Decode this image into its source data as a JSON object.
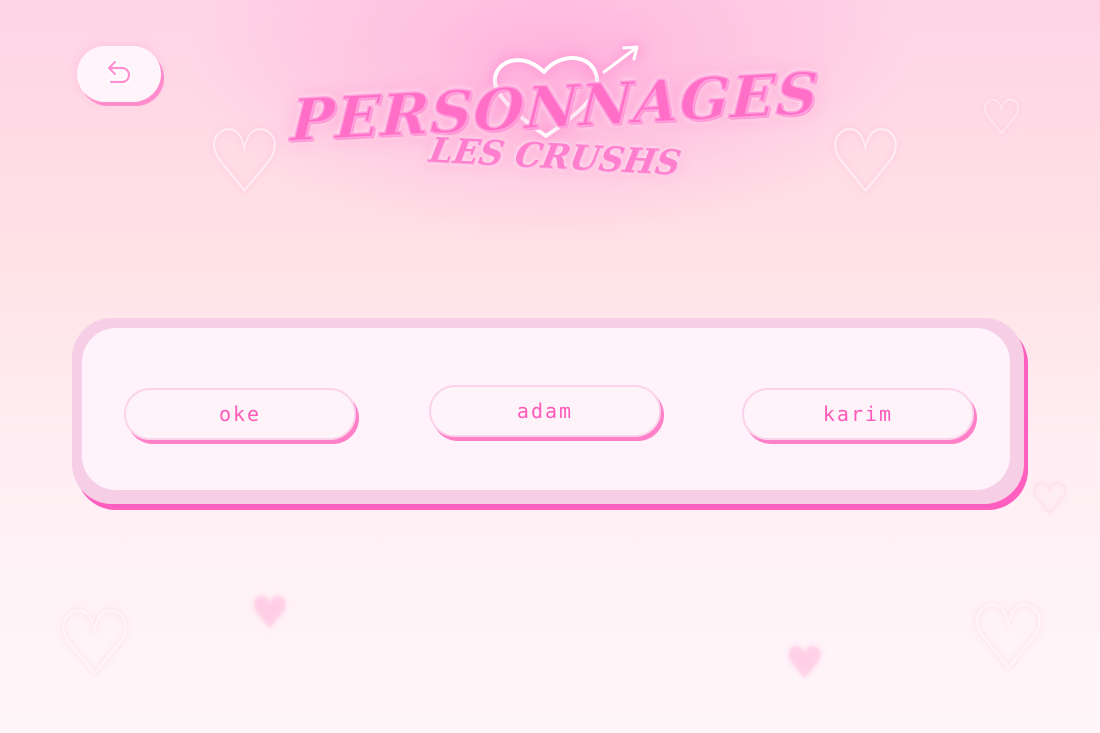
{
  "header": {
    "back_icon": "back-arrow-icon",
    "title": "PERSONNAGES",
    "subtitle": "LES CRUSHS",
    "emblem_icon": "neon-heart-arrow-icon"
  },
  "characters": [
    {
      "label": "OKE"
    },
    {
      "label": "ADAM"
    },
    {
      "label": "KARIM"
    }
  ],
  "colors": {
    "accent": "#ff5ab9",
    "shadow": "#ff5fbe",
    "panel": "#fff2fa"
  }
}
